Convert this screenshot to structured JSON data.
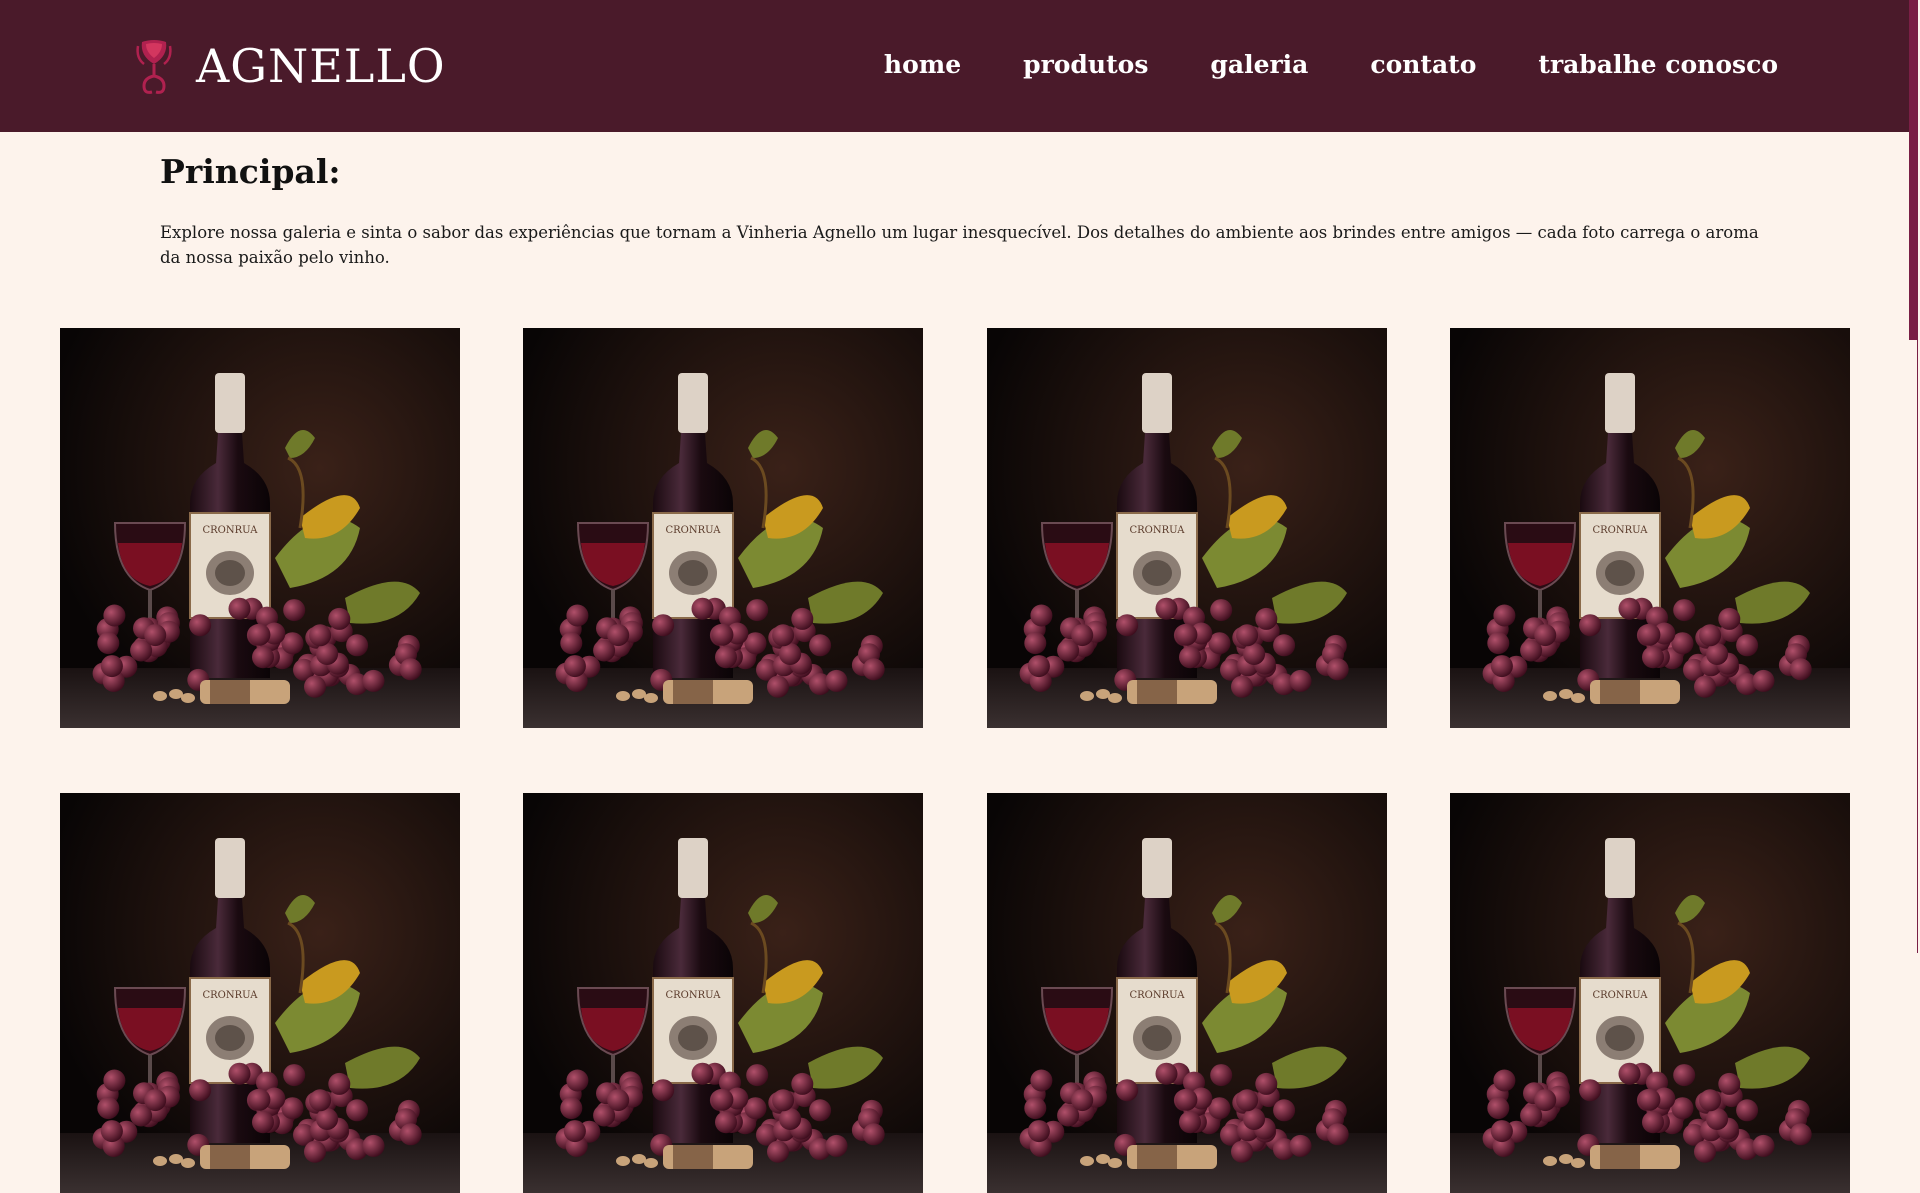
{
  "brand": {
    "name": "AGNELLO",
    "logo_icon": "wine-glass-logo-icon",
    "colors": {
      "header_bg": "#4a1a2a",
      "page_bg": "#fdf3ec",
      "accent": "#b0214f"
    }
  },
  "nav": {
    "items": [
      {
        "label": "home"
      },
      {
        "label": "produtos"
      },
      {
        "label": "galeria"
      },
      {
        "label": "contato"
      },
      {
        "label": "trabalhe conosco"
      }
    ]
  },
  "main": {
    "title": "Principal:",
    "intro": "Explore nossa galeria e sinta o sabor das experiências que tornam a Vinheria Agnello um lugar inesquecível. Dos detalhes do ambiente aos brindes entre amigos — cada foto carrega o aroma da nossa paixão pelo vinho."
  },
  "gallery": {
    "image_subject": "wine-bottle-grapes-photo",
    "label_text": "CRONRUA",
    "count_visible": 8
  }
}
